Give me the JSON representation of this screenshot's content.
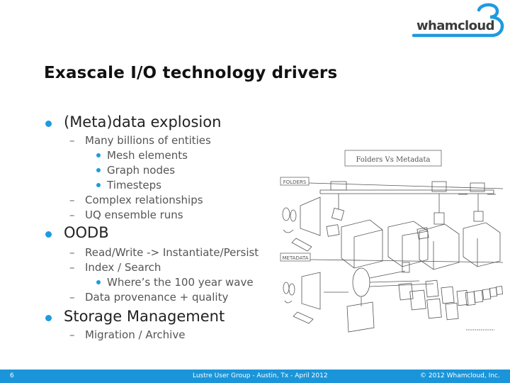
{
  "brand": {
    "logo_text": "whamcloud",
    "accent_color": "#1f9ae0"
  },
  "slide": {
    "title": "Exascale I/O technology drivers",
    "bullets": [
      {
        "text": "(Meta)data explosion",
        "children": [
          {
            "text": "Many billions of entities",
            "children": [
              "Mesh elements",
              "Graph nodes",
              "Timesteps"
            ]
          },
          {
            "text": "Complex relationships",
            "children": []
          },
          {
            "text": "UQ ensemble runs",
            "children": []
          }
        ]
      },
      {
        "text": "OODB",
        "children": [
          {
            "text": "Read/Write -> Instantiate/Persist",
            "children": []
          },
          {
            "text": "Index / Search",
            "children": [
              "Where’s the 100 year wave"
            ]
          },
          {
            "text": "Data provenance + quality",
            "children": []
          }
        ]
      },
      {
        "text": "Storage Management",
        "children": [
          {
            "text": "Migration / Archive",
            "children": []
          }
        ]
      }
    ]
  },
  "sketch": {
    "heading": "Folders Vs Metadata",
    "label_top": "FOLDERS",
    "label_bottom": "METADATA"
  },
  "footer": {
    "page_number": "6",
    "event": "Lustre User Group - Austin, Tx - April 2012",
    "copyright": "© 2012 Whamcloud, Inc.",
    "background_color": "#1b95d9"
  }
}
